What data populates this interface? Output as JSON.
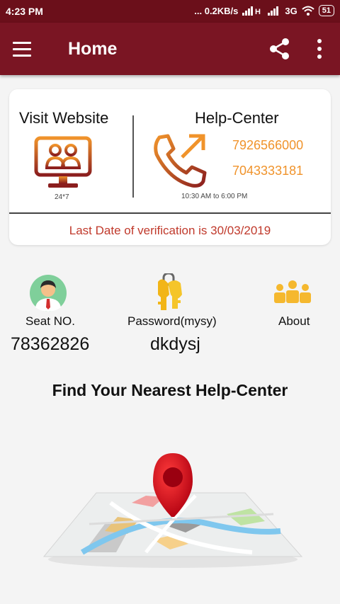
{
  "status_bar": {
    "time": "4:23 PM",
    "network_speed": "... 0.2KB/s",
    "network_type": "3G",
    "battery": "51"
  },
  "app_bar": {
    "title": "Home",
    "menu_icon": "hamburger-menu-icon",
    "share_icon": "share-icon",
    "more_icon": "more-vert-icon"
  },
  "info_card": {
    "visit_title": "Visit Website",
    "visit_hours": "24*7",
    "help_title": "Help-Center",
    "phone_1": "7926566000",
    "phone_2": "7043333181",
    "help_hours": "10:30 AM to 6:00 PM",
    "verification_text": "Last Date of verification is 30/03/2019"
  },
  "details": {
    "seat_label": "Seat NO.",
    "seat_value": "78362826",
    "password_label": "Password(mysy)",
    "password_value": "dkdysj",
    "about_label": "About"
  },
  "find_title": "Find Your Nearest Help-Center",
  "colors": {
    "primary": "#7a1523",
    "status_bar": "#6b0f1a",
    "accent_orange": "#f0932b",
    "verification_red": "#c0392b"
  }
}
